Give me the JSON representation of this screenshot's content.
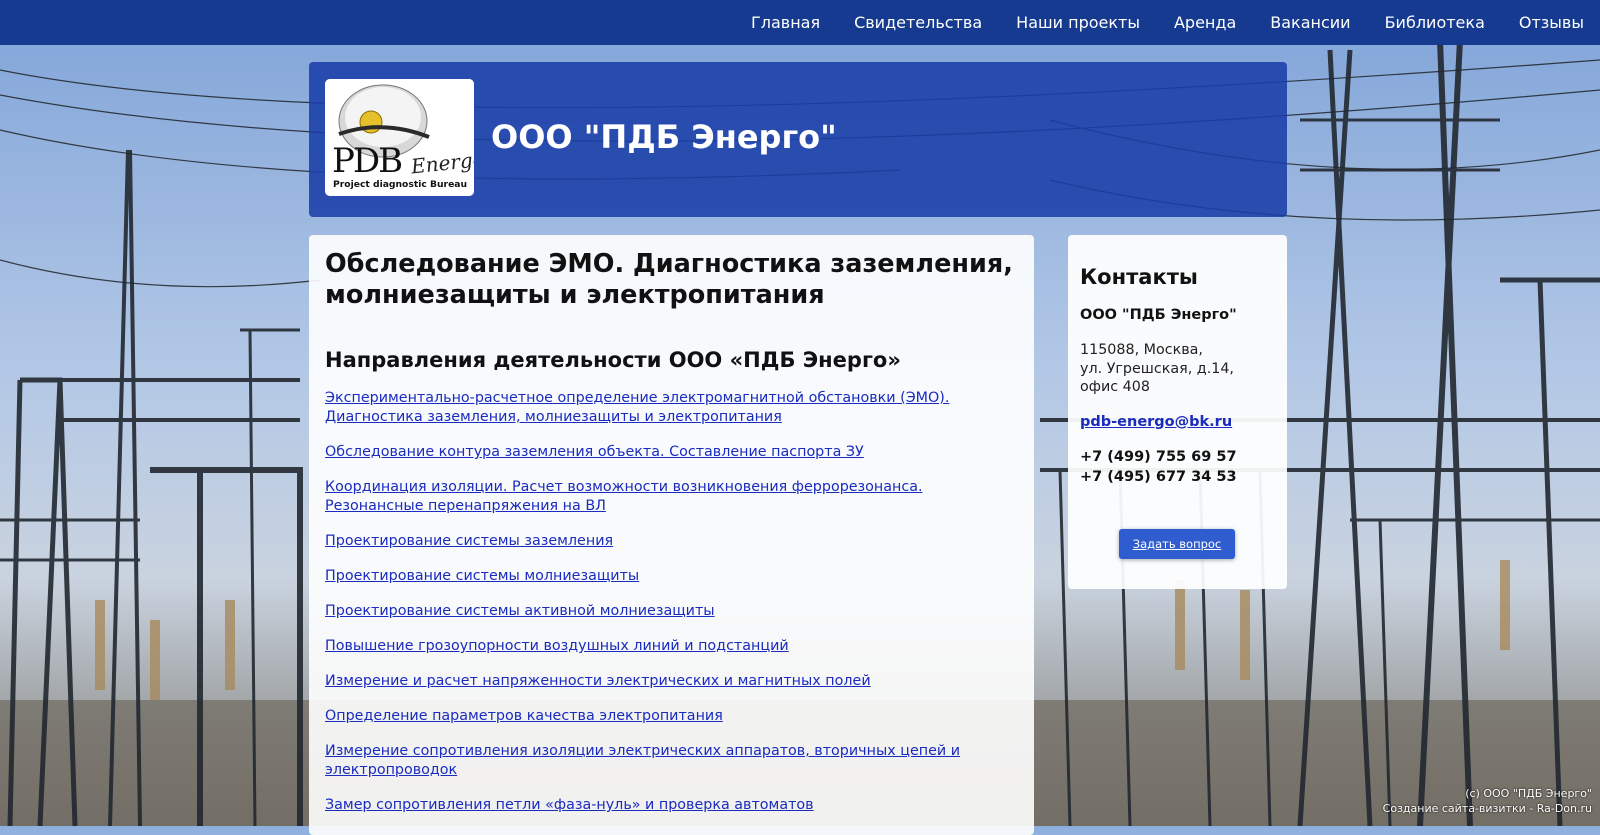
{
  "colors": {
    "nav_bg": "#153a8f",
    "header_bg": "#1a3da8",
    "link": "#1a2bbf",
    "button_bg": "#2f5dd0"
  },
  "nav": {
    "items": [
      {
        "label": "Главная"
      },
      {
        "label": "Свидетельства"
      },
      {
        "label": "Наши проекты"
      },
      {
        "label": "Аренда"
      },
      {
        "label": "Вакансии"
      },
      {
        "label": "Библиотека"
      },
      {
        "label": "Отзывы"
      }
    ]
  },
  "header": {
    "title": "ООО \"ПДБ Энерго\"",
    "logo": {
      "main": "PDB",
      "script": "Energo",
      "tagline": "Project diagnostic Bureau"
    }
  },
  "main": {
    "heading": "Обследование ЭМО. Диагностика заземления, молниезащиты и электропитания",
    "subheading": "Направления деятельности ООО «ПДБ Энерго»",
    "links": [
      "Экспериментально-расчетное определение электромагнитной обстановки (ЭМО). Диагностика заземления, молниезащиты и электропитания",
      "Обследование контура заземления объекта. Составление паспорта ЗУ",
      "Координация изоляции. Расчет возможности возникновения феррорезонанса. Резонансные перенапряжения на ВЛ",
      "Проектирование системы заземления",
      "Проектирование системы молниезащиты",
      "Проектирование системы активной молниезащиты",
      "Повышение грозоупорности воздушных линий и подстанций",
      "Измерение и расчет напряженности электрических и магнитных полей",
      "Определение параметров качества электропитания",
      "Измерение сопротивления изоляции электрических аппаратов, вторичных цепей и электропроводок",
      "Замер сопротивления петли «фаза-нуль» и проверка автоматов"
    ]
  },
  "contacts": {
    "title": "Контакты",
    "company": "ООО \"ПДБ Энерго\"",
    "address": [
      "115088, Москва,",
      "ул. Угрешская, д.14,",
      "офис 408"
    ],
    "email": "pdb-energo@bk.ru",
    "phones": [
      "+7 (499) 755 69 57",
      "+7 (495) 677 34 53"
    ],
    "button": "Задать вопрос"
  },
  "footer": {
    "copyright": "(c) ООО \"ПДБ Энерго\"",
    "credit": "Создание сайта-визитки - Ra-Don.ru"
  }
}
